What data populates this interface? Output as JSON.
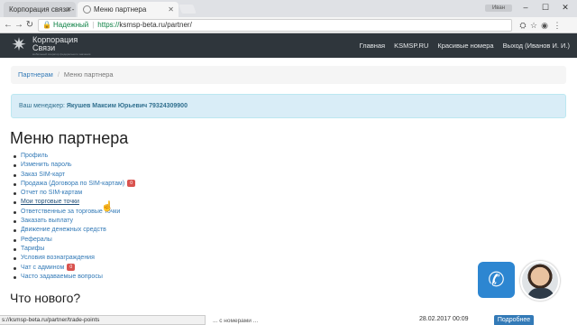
{
  "browser": {
    "tabs": [
      {
        "label": "Корпорация связи - ма"
      },
      {
        "label": "Меню партнера"
      }
    ],
    "profile_label": "Иван",
    "address": {
      "secure_label": "Надежный",
      "url_scheme": "https://",
      "url_rest": "ksmsp-beta.ru/partner/"
    }
  },
  "site": {
    "logo_line1": "Корпорация",
    "logo_line2": "Связи",
    "logo_tagline": "мобильный оператор федерального значения",
    "nav": {
      "home": "Главная",
      "ksmsp": "KSMSP.RU",
      "numbers": "Красивые номера",
      "logout": "Выход (Иванов И. И.)"
    }
  },
  "breadcrumb": {
    "parent": "Партнерам",
    "current": "Меню партнера"
  },
  "alert": {
    "prefix": "Ваш менеджер:",
    "manager": "Якушев Максим Юрьевич 79324309900"
  },
  "main": {
    "title": "Меню партнера",
    "menu": [
      {
        "label": "Профиль"
      },
      {
        "label": "Изменить пароль"
      },
      {
        "label": "Заказ SIM-карт"
      },
      {
        "label": "Продажа (Договора по SIM-картам)",
        "badge": "0"
      },
      {
        "label": "Отчет по SIM-картам"
      },
      {
        "label": "Мои торговые точки"
      },
      {
        "label": "Ответственные за торговые точки"
      },
      {
        "label": "Заказать выплату"
      },
      {
        "label": "Движение денежных средств"
      },
      {
        "label": "Рефералы"
      },
      {
        "label": "Тарифы"
      },
      {
        "label": "Условия вознаграждения"
      },
      {
        "label": "Чат с админом",
        "badge": "0"
      },
      {
        "label": "Часто задаваемые вопросы"
      }
    ],
    "news_title": "Что нового?",
    "news_fragment": "... с номерами ...",
    "news_date": "28.02.2017 00:09",
    "more_label": "Подробнее"
  },
  "status_url": "s://ksmsp-beta.ru/partner/trade-points",
  "colors": {
    "navbar": "#2f363c",
    "link": "#337ab7",
    "alert_bg": "#d9edf7",
    "call_button": "#2d86d1",
    "badge": "#d9534f"
  }
}
